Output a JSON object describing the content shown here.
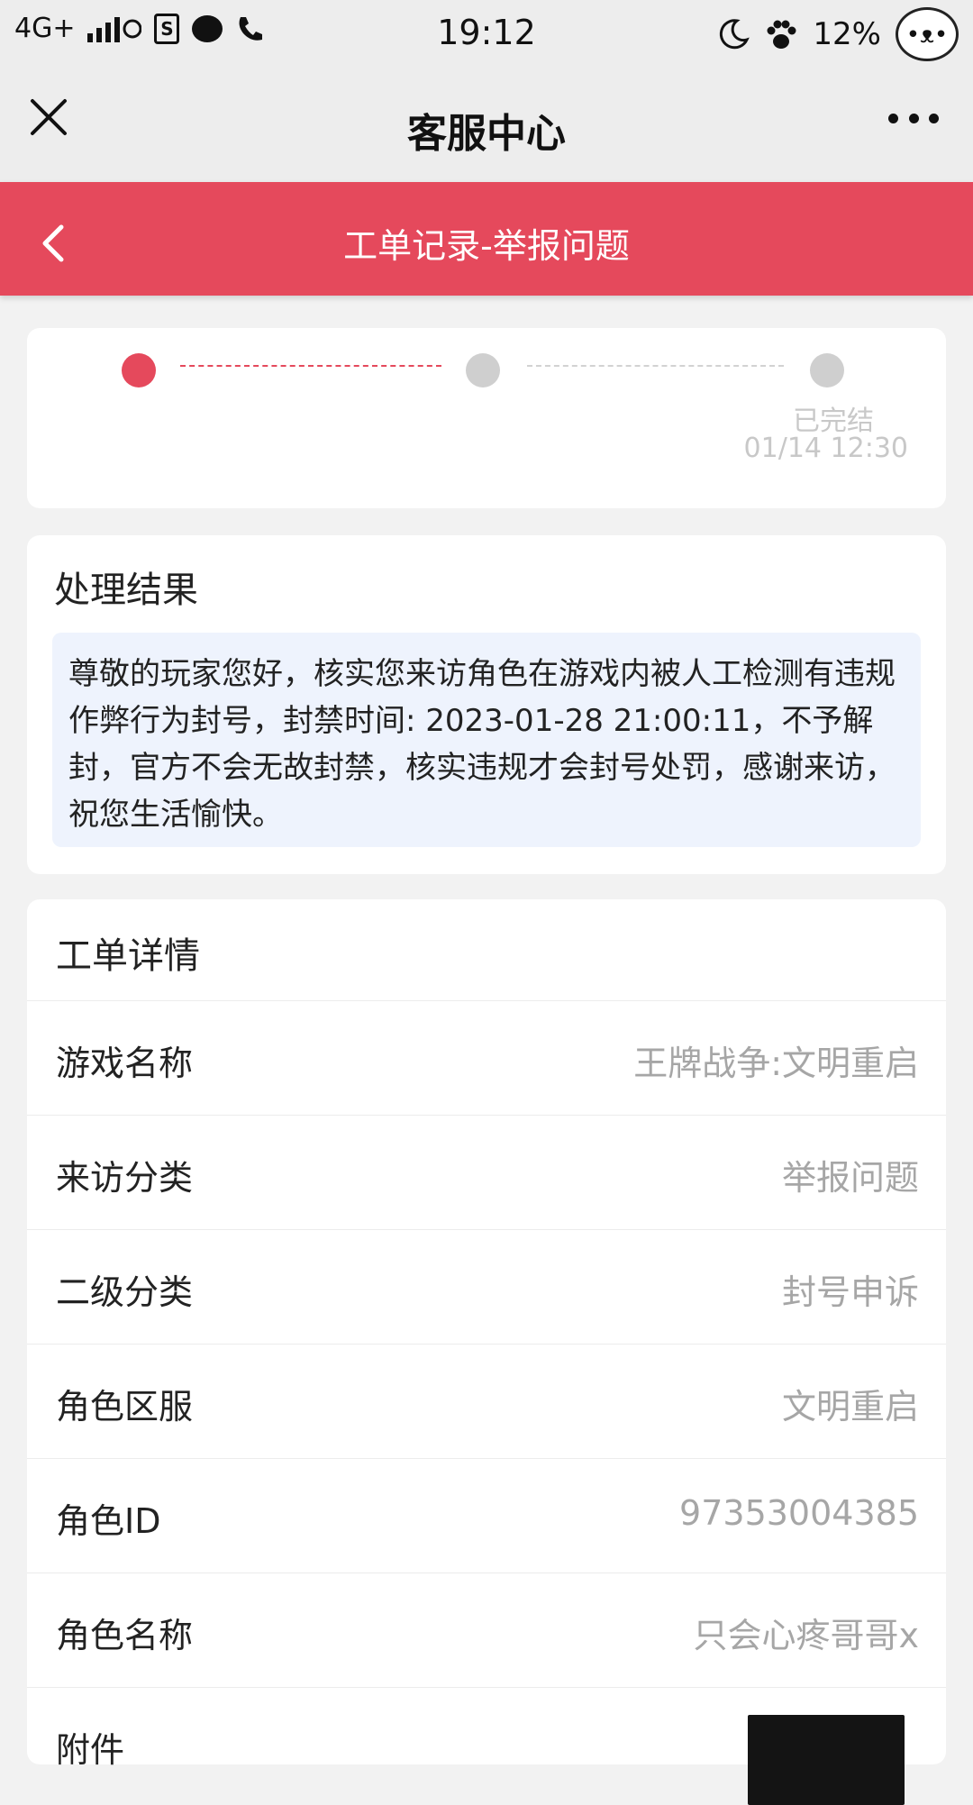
{
  "status_bar": {
    "network": "4G+",
    "time": "19:12",
    "battery": "12%"
  },
  "nav": {
    "title": "客服中心"
  },
  "header": {
    "title": "工单记录-举报问题"
  },
  "progress": {
    "completed_label": "已完结",
    "completed_time": "01/14 12:30"
  },
  "result": {
    "title": "处理结果",
    "message": "尊敬的玩家您好，核实您来访角色在游戏内被人工检测有违规作弊行为封号，封禁时间: 2023-01-28 21:00:11，不予解封，官方不会无故封禁，核实违规才会封号处罚，感谢来访，祝您生活愉快。"
  },
  "details": {
    "title": "工单详情",
    "rows": [
      {
        "label": "游戏名称",
        "value": "王牌战争:文明重启"
      },
      {
        "label": "来访分类",
        "value": "举报问题"
      },
      {
        "label": "二级分类",
        "value": "封号申诉"
      },
      {
        "label": "角色区服",
        "value": "文明重启"
      },
      {
        "label": "角色ID",
        "value": "97353004385"
      },
      {
        "label": "角色名称",
        "value": "只会心疼哥哥x"
      }
    ],
    "attachment_label": "附件"
  },
  "colors": {
    "accent": "#e5495c",
    "inactive": "#cfcfcf",
    "result_bg": "#eef3fd"
  }
}
